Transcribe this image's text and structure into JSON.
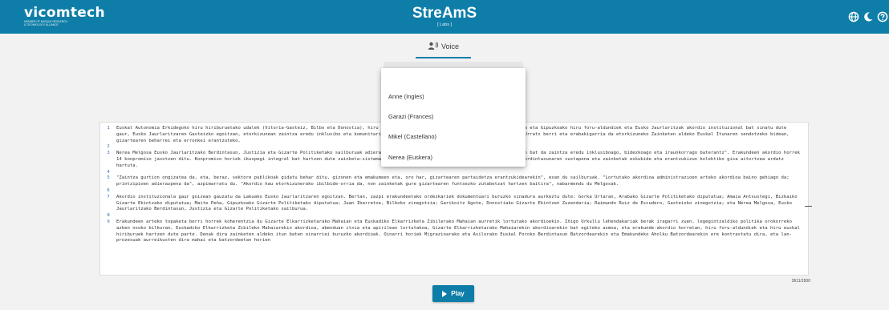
{
  "header": {
    "logo_name": "vicomtech",
    "logo_subtitle_1": "MEMBER OF BASQUE RESEARCH",
    "logo_subtitle_2": "& TECHNOLOGY ALLIANCE",
    "app_title": "StreAmS",
    "app_subtitle": "[ Labs ]",
    "icons": [
      "globe-icon",
      "moon-icon",
      "help-icon"
    ],
    "color": "#0e7ea8"
  },
  "tabs": [
    {
      "label": "Voice",
      "icon": "voice-icon",
      "active": true
    }
  ],
  "voice_menu": {
    "options": [
      "Anne (Ingles)",
      "Garazi (Frances)",
      "Mikel (Castellano)",
      "Nerea (Euskera)"
    ]
  },
  "editor": {
    "lines": [
      {
        "num": "1",
        "text": "Euskal Autonomia Erkidegoko hiru hiriburuetako udalek (Vitoria-Gasteiz, Bilbo eta Donostia), hiru lurralde historikoetako foru-aldundiek (Araba, Bizkaia eta Gipuzkoako hiru foru-aldundiek eta Eusko Jaurlaritzak akordio instituzional bat sinatu dute gaur, Eusko Jaurlaritzaren Gasteizko egoitzan, etorkizunean zaintza eredu inklusibo eta komunitario baterantz aurrera egiteko konpromiso bat lortzeko. Urrats berri eta erabakigarria da etorkizuneko Zainketen aldeko Euskal Itunaren sendotzeko bidean, gizartearen beharrei eta erronkei erantzuteko."
      },
      {
        "num": "2",
        "text": ""
      },
      {
        "num": "3",
        "text": "Nerea Melgosa Eusko Jaurlaritzako Berdintasun, Justizia eta Gizarte Politiketako sailburuak adierazi duenez, akordio honek ahalbidetuko du \"aurrerapauso bat da zaintza eredu inklusiboago, bidezkoago eta iraunkorrago baterantz\". Erakundeen akordio horrek 14 konpromiso jasotzen ditu. Konpromiso horiek ikuspegi integral bat hartzen dute zainketa-sistema hobetzeko, sektoreko enpleguaren kalitatea, genero-berdintasunaren sustapena eta zainketak eskubide eta erantzukizun kolektibo gisa aitortzea ardatz hartuta."
      },
      {
        "num": "4",
        "text": ""
      },
      {
        "num": "5",
        "text": "\"Zaintza gurtion ongizatea da, eta, beraz, sektore publikoak gidatu behar ditu, gizonen eta emakumeen eta, oro har, gizartearen partaidetza erantzukidearekin\", esan du sailburuak. \"Lortutako akordioa administrazioen arteko akordioa baino gehiago da; printzipioen adierazpena da\", azpimarratu du. \"Akordio hau etorkizunerako ibilbide-orria da, non zainketak gure gizartearen funtsezko zutabetzat hartzen baitira\", nabarmendu du Melgosak."
      },
      {
        "num": "6",
        "text": ""
      },
      {
        "num": "7",
        "text": "Akordio instituzionala gaur goizean gauzatu da Lakuako Eusko Jaurlaritzaren egoitzan. Bertan, zazpi erakundeetako ordezkariek dokumentuari buruzko sinadura aurkeztu dute: Gorka Urtaran, Arabako Gizarte Politiketako diputatua; Amaia Antxustegi, Bizkaiko Gizarte Ekintzako diputatua; Maite Peña, Gipuzkoako Gizarte Politiketako diputatua; Juan Ibarretxe, Bilboko zinegotzia; Garikoitz Agote, Donostiako Gizarte Ekintzen Zuzendaria; Raimundo Ruiz de Escudero, Gasteizko zinegotzia; eta Nerea Melgosa, Eusko Jaurlaritzako Berdintasun, Justizia eta Gizarte Politiketako sailburua."
      },
      {
        "num": "8",
        "text": ""
      },
      {
        "num": "9",
        "text": "Erakundeen arteko topaketa berri horrek koherentzia du Gizarte Elkarrizketarako Mahaian eta Euskadiko Elkarrizketa Zibilerako Mahaian aurretik lortutako akordioekin. Iñigo Urkullu lehendakariak berak iragarri zuen, legegintzaldiko politika orokorreko azken osoko bilkuran, Euskadiko Elkarrizketa Zibileko Mahaiarekin akordioa, abenduan itxia eta apirilean lortutakoa, Gizarte Elkarrizketarako Mahaiarekin akordioarekin bat egiteko asmoa, eta erakunde-akordio horretan, hiru foru-aldundiek eta hiru euskal hiriburuek hartzen dute parte. Denak dira zainketen aldeko itun baten oinarriei buruzko akordioak. Oinarri horiek Migrazioarako eta Asilorako Euskal Foroko Berdintasun Batzordearekin eta Emakundeko Aholku Batzordearekin ere kontrastatu dira, eta lan-prozesuak aurreikusten dira mahai eta batzordeetan horien"
      }
    ]
  },
  "counter": "3611/1500",
  "play_label": "Play"
}
